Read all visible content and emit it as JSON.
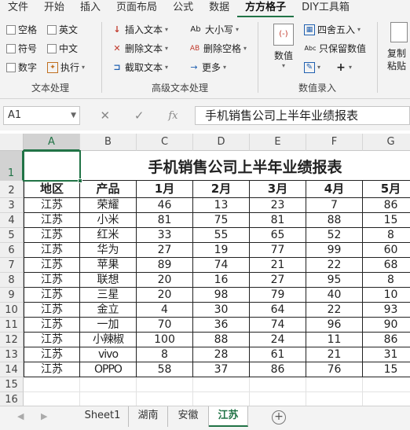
{
  "ribbon_tabs": [
    "文件",
    "开始",
    "插入",
    "页面布局",
    "公式",
    "数据",
    "方方格子",
    "DIY工具箱"
  ],
  "active_tab_index": 6,
  "groups": {
    "text_processing": {
      "label": "文本处理",
      "checkboxes": [
        "空格",
        "英文",
        "符号",
        "中文",
        "数字"
      ],
      "execute": "执行"
    },
    "advanced_text": {
      "label": "高级文本处理",
      "items": [
        "插入文本",
        "删除文本",
        "截取文本",
        "大小写",
        "删除空格",
        "更多"
      ]
    },
    "numeric_entry": {
      "label": "数值录入",
      "big_button": "数值",
      "items": [
        "四舍五入",
        "只保留数值"
      ]
    },
    "copy": {
      "label": "复制粘贴"
    }
  },
  "name_box": "A1",
  "formula_value": "手机销售公司上半年业绩报表",
  "columns": [
    "A",
    "B",
    "C",
    "D",
    "E",
    "F",
    "G"
  ],
  "row_numbers": [
    "1",
    "2",
    "3",
    "4",
    "5",
    "6",
    "7",
    "8",
    "9",
    "10",
    "11",
    "12",
    "13",
    "14",
    "15",
    "16"
  ],
  "table": {
    "title": "手机销售公司上半年业绩报表",
    "headers": [
      "地区",
      "产品",
      "1月",
      "2月",
      "3月",
      "4月",
      "5月"
    ],
    "rows": [
      [
        "江苏",
        "荣耀",
        "46",
        "13",
        "23",
        "7",
        "86"
      ],
      [
        "江苏",
        "小米",
        "81",
        "75",
        "81",
        "88",
        "15"
      ],
      [
        "江苏",
        "红米",
        "33",
        "55",
        "65",
        "52",
        "8"
      ],
      [
        "江苏",
        "华为",
        "27",
        "19",
        "77",
        "99",
        "60"
      ],
      [
        "江苏",
        "苹果",
        "89",
        "74",
        "21",
        "22",
        "68"
      ],
      [
        "江苏",
        "联想",
        "20",
        "16",
        "27",
        "95",
        "8"
      ],
      [
        "江苏",
        "三星",
        "20",
        "98",
        "79",
        "40",
        "10"
      ],
      [
        "江苏",
        "金立",
        "4",
        "30",
        "64",
        "22",
        "93"
      ],
      [
        "江苏",
        "一加",
        "70",
        "36",
        "74",
        "96",
        "90"
      ],
      [
        "江苏",
        "小辣椒",
        "100",
        "88",
        "24",
        "11",
        "86"
      ],
      [
        "江苏",
        "vivo",
        "8",
        "28",
        "61",
        "21",
        "31"
      ],
      [
        "江苏",
        "OPPO",
        "58",
        "37",
        "86",
        "76",
        "15"
      ]
    ]
  },
  "sheet_tabs": [
    "Sheet1",
    "湖南",
    "安徽",
    "江苏"
  ],
  "active_sheet_index": 3,
  "accent_color": "#217346"
}
